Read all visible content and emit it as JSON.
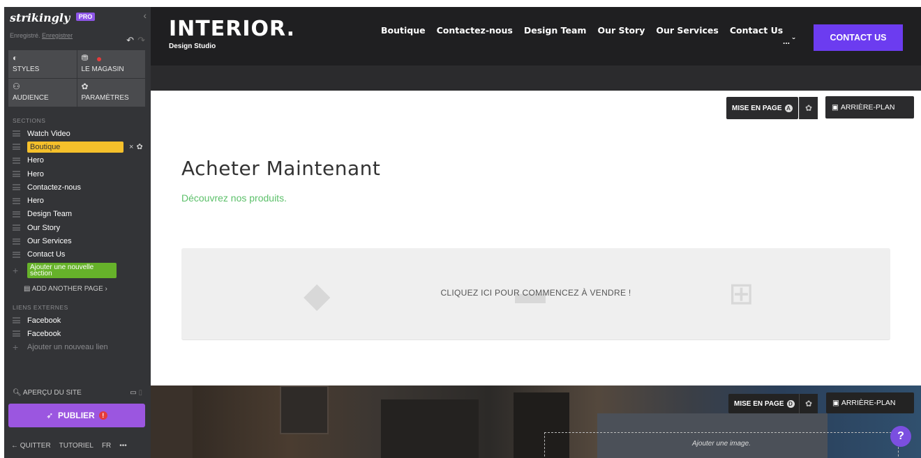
{
  "sidebar": {
    "logo": "strikingly",
    "pro_badge": "PRO",
    "saved_text": "Enregistré.",
    "save_link": "Enregistrer",
    "tiles": [
      {
        "label": "STYLES",
        "icon": "palette-icon"
      },
      {
        "label": "LE MAGASIN",
        "icon": "shopping-bag-icon"
      },
      {
        "label": "AUDIENCE",
        "icon": "people-icon"
      },
      {
        "label": "PARAMÈTRES",
        "icon": "gear-icon"
      }
    ],
    "sections_heading": "SECTIONS",
    "sections": [
      {
        "label": "Watch Video"
      },
      {
        "label": "Boutique",
        "active": true
      },
      {
        "label": "Hero"
      },
      {
        "label": "Hero"
      },
      {
        "label": "Contactez-nous"
      },
      {
        "label": "Hero"
      },
      {
        "label": "Design Team"
      },
      {
        "label": "Our Story"
      },
      {
        "label": "Our Services"
      },
      {
        "label": "Contact Us"
      }
    ],
    "add_section": "Ajouter une nouvelle section",
    "add_page": "ADD ANOTHER PAGE ›",
    "external_links_heading": "LIENS EXTERNES",
    "external_links": [
      {
        "label": "Facebook"
      },
      {
        "label": "Facebook"
      }
    ],
    "add_link": "Ajouter un nouveau lien",
    "preview": "APERÇU DU SITE",
    "preview_count": "0",
    "publish": "PUBLIER",
    "footer": {
      "quit": "QUITTER",
      "tutorial": "TUTORIEL",
      "lang": "FR",
      "more": "•••"
    }
  },
  "site_header": {
    "brand": "INTERIOR.",
    "tagline": "Design Studio",
    "nav": [
      "Boutique",
      "Contactez-nous",
      "Design Team",
      "Our Story",
      "Our Services",
      "Contact Us"
    ],
    "more": "... ˇ",
    "cta": "CONTACT US"
  },
  "main": {
    "layout_button": "MISE EN PAGE",
    "layout_badge": "A",
    "background_button": "ARRIÈRE-PLAN",
    "heading": "Acheter Maintenant",
    "subheading": "Découvrez nos produits.",
    "shop_prompt": "CLIQUEZ ICI POUR COMMENCEZ À VENDRE !",
    "colors": {
      "accent_green": "#5cc06a",
      "cta_purple": "#6c3cf0",
      "active_section": "#f5c02b",
      "add_section_green": "#66b22a"
    }
  },
  "hero": {
    "layout_button": "MISE EN PAGE",
    "layout_badge": "D",
    "background_button": "ARRIÈRE-PLAN",
    "image_prompt": "Ajouter une image.",
    "help": "?"
  }
}
